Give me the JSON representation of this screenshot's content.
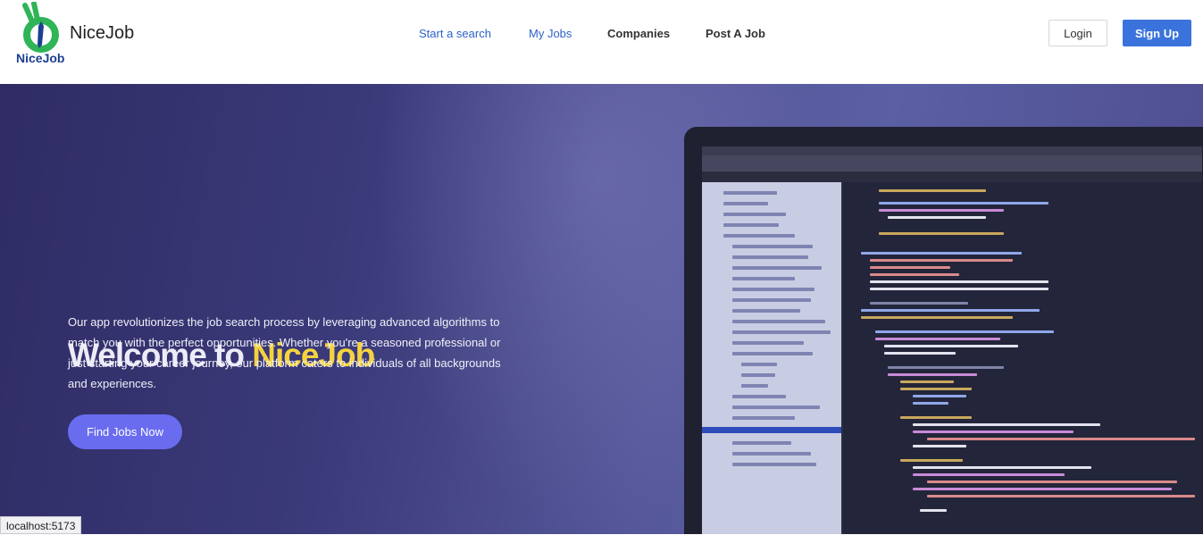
{
  "header": {
    "logo_word": "NiceJob",
    "brand": "NiceJob",
    "nav": {
      "start_search": "Start a search",
      "my_jobs": "My Jobs",
      "companies": "Companies",
      "post_job": "Post A Job"
    },
    "login": "Login",
    "signup": "Sign Up"
  },
  "hero": {
    "title_prefix": "Welcome to ",
    "title_accent": "NiceJob",
    "description": "Our app revolutionizes the job search process by leveraging advanced algorithms to match you with the perfect opportunities. Whether you're a seasoned professional or just starting your career journey, our platform caters to individuals of all backgrounds and experiences.",
    "cta": "Find Jobs Now",
    "background_image": "laptop-code-editor"
  },
  "status_bar": {
    "url": "localhost:5173"
  },
  "colors": {
    "accent_yellow": "#f5d33e",
    "nav_blue": "#2d63c8",
    "signup_blue": "#3a73dc",
    "cta_purple": "#6a6cf0",
    "logo_green": "#2fb457"
  }
}
